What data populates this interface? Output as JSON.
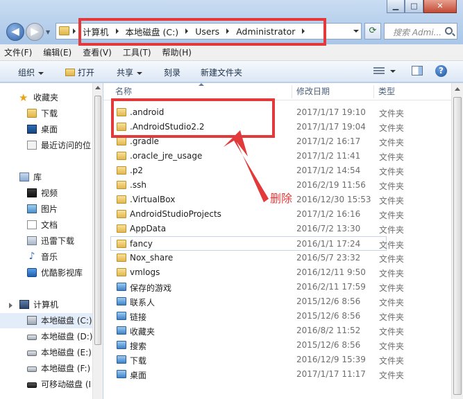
{
  "window": {
    "minimize_glyph": "▁",
    "maximize_glyph": "□",
    "close_glyph": "✕"
  },
  "address": {
    "breadcrumbs": [
      "计算机",
      "本地磁盘 (C:)",
      "Users",
      "Administrator"
    ]
  },
  "search": {
    "placeholder": "搜索 Admi..."
  },
  "menu": [
    "文件(F)",
    "编辑(E)",
    "查看(V)",
    "工具(T)",
    "帮助(H)"
  ],
  "toolbar": {
    "organize": "组织",
    "open": "打开",
    "share": "共享",
    "burn": "刻录",
    "new_folder": "新建文件夹"
  },
  "nav": {
    "favorites": "收藏夹",
    "downloads": "下载",
    "desktop": "桌面",
    "recent": "最近访问的位",
    "libraries": "库",
    "videos": "视频",
    "pictures": "图片",
    "documents": "文档",
    "xunlei": "迅雷下载",
    "music": "音乐",
    "youku": "优酷影视库",
    "computer": "计算机",
    "drive_c": "本地磁盘 (C:)",
    "drive_d": "本地磁盘 (D:)",
    "drive_e": "本地磁盘 (E:)",
    "drive_f": "本地磁盘 (F:)",
    "removable": "可移动磁盘 (I"
  },
  "columns": {
    "name": "名称",
    "date": "修改日期",
    "type": "类型"
  },
  "files": [
    {
      "name": ".android",
      "date": "2017/1/17 19:10",
      "type": "文件夹",
      "icon": "folder"
    },
    {
      "name": ".AndroidStudio2.2",
      "date": "2017/1/17 19:04",
      "type": "文件夹",
      "icon": "folder"
    },
    {
      "name": ".gradle",
      "date": "2017/1/2 16:17",
      "type": "文件夹",
      "icon": "folder"
    },
    {
      "name": ".oracle_jre_usage",
      "date": "2017/1/2 11:41",
      "type": "文件夹",
      "icon": "folder"
    },
    {
      "name": ".p2",
      "date": "2017/1/2 14:54",
      "type": "文件夹",
      "icon": "folder"
    },
    {
      "name": ".ssh",
      "date": "2016/2/19 11:56",
      "type": "文件夹",
      "icon": "folder"
    },
    {
      "name": ".VirtualBox",
      "date": "2016/12/30 15:53",
      "type": "文件夹",
      "icon": "folder"
    },
    {
      "name": "AndroidStudioProjects",
      "date": "2017/1/2 16:16",
      "type": "文件夹",
      "icon": "folder"
    },
    {
      "name": "AppData",
      "date": "2016/7/2 13:30",
      "type": "文件夹",
      "icon": "folder"
    },
    {
      "name": "fancy",
      "date": "2016/1/1 17:24",
      "type": "文件夹",
      "icon": "folder"
    },
    {
      "name": "Nox_share",
      "date": "2016/5/7 23:32",
      "type": "文件夹",
      "icon": "folder"
    },
    {
      "name": "vmlogs",
      "date": "2016/12/11 9:50",
      "type": "文件夹",
      "icon": "folder"
    },
    {
      "name": "保存的游戏",
      "date": "2016/2/11 17:59",
      "type": "文件夹",
      "icon": "special"
    },
    {
      "name": "联系人",
      "date": "2015/12/6 8:56",
      "type": "文件夹",
      "icon": "special"
    },
    {
      "name": "链接",
      "date": "2015/12/6 8:56",
      "type": "文件夹",
      "icon": "special"
    },
    {
      "name": "收藏夹",
      "date": "2016/8/2 11:52",
      "type": "文件夹",
      "icon": "special"
    },
    {
      "name": "搜索",
      "date": "2015/12/6 8:56",
      "type": "文件夹",
      "icon": "special"
    },
    {
      "name": "下载",
      "date": "2016/12/9 15:39",
      "type": "文件夹",
      "icon": "special"
    },
    {
      "name": "桌面",
      "date": "2017/1/17 11:17",
      "type": "文件夹",
      "icon": "special"
    }
  ],
  "annotation": {
    "label": "删除",
    "color": "#e23a3a"
  }
}
